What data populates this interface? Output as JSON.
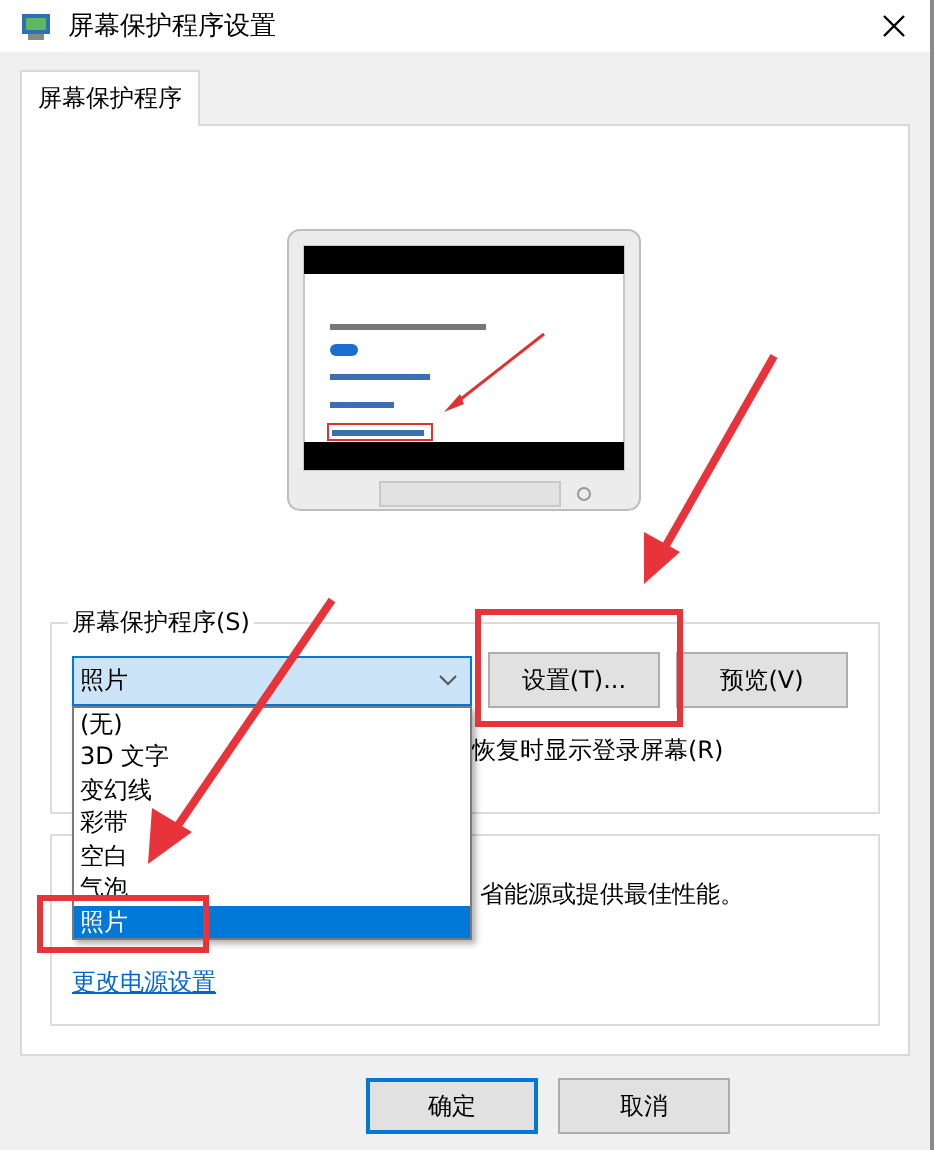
{
  "window": {
    "title": "屏幕保护程序设置"
  },
  "tabs": [
    {
      "label": "屏幕保护程序",
      "selected": true
    }
  ],
  "screen_saver": {
    "label": "屏幕保护程序(S)",
    "dropdown": {
      "value": "照片",
      "expanded": true,
      "options": [
        {
          "label": "(无)",
          "selected": false
        },
        {
          "label": "3D 文字",
          "selected": false
        },
        {
          "label": "变幻线",
          "selected": false
        },
        {
          "label": "彩带",
          "selected": false
        },
        {
          "label": "空白",
          "selected": false
        },
        {
          "label": "气泡",
          "selected": false
        },
        {
          "label": "照片",
          "selected": true
        }
      ]
    },
    "buttons": [
      "设置(T)...",
      "预览(V)"
    ],
    "resume_option": "恢复时显示登录屏幕(R)"
  },
  "power": {
    "description": "省能源或提供最佳性能。",
    "link": "更改电源设置"
  },
  "buttons": [
    {
      "label": "确定",
      "default": true
    },
    {
      "label": "取消",
      "default": false
    }
  ]
}
